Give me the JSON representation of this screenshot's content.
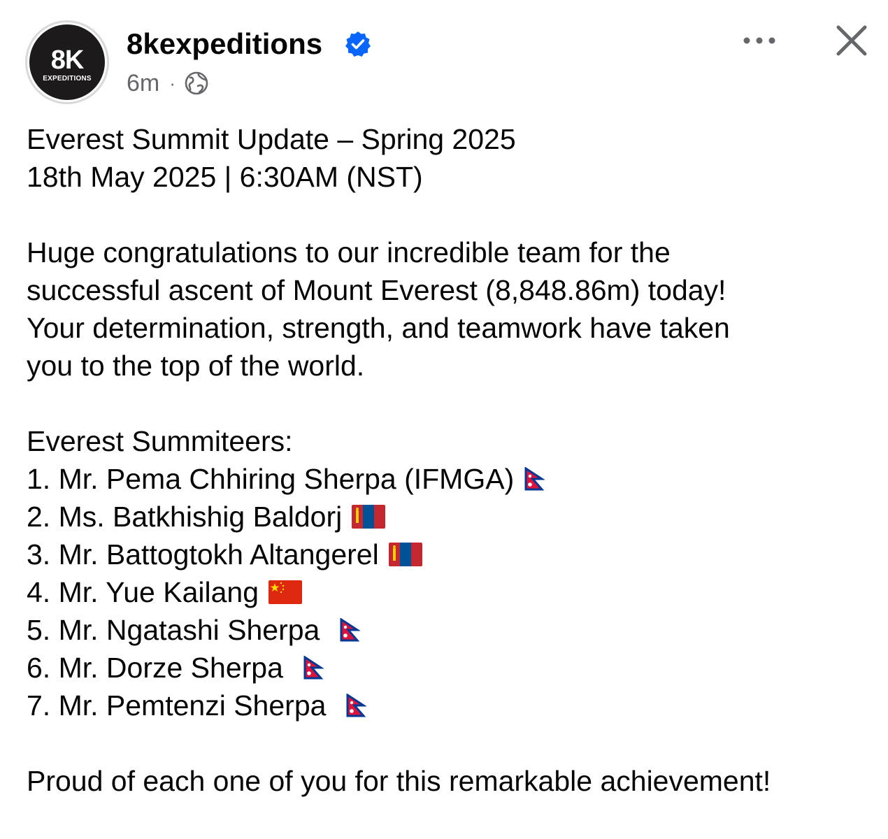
{
  "header": {
    "avatar_mark": "8K",
    "avatar_sub": "EXPEDITIONS",
    "account_name": "8kexpeditions",
    "time_ago": "6m",
    "separator": "·",
    "privacy_icon": "globe-icon",
    "verified_icon": "verified-badge-icon",
    "more_icon": "more-options-icon",
    "close_icon": "close-icon",
    "verified_color": "#0866ff"
  },
  "post": {
    "title": "Everest Summit Update – Spring 2025",
    "datetime": "18th May 2025 | 6:30AM (NST)",
    "paragraph_lines": [
      "Huge congratulations to our incredible team for the",
      "successful ascent of Mount Everest (8,848.86m) today!",
      "Your determination, strength, and teamwork have taken",
      "you to the top of the world."
    ],
    "summiteers_heading": "Everest Summiteers:",
    "summiteers": [
      {
        "text": "1. Mr. Pema Chhiring Sherpa (IFMGA)",
        "flag": "nepal-flag-icon"
      },
      {
        "text": "2. Ms. Batkhishig Baldorj",
        "flag": "mongolia-flag-icon"
      },
      {
        "text": "3. Mr. Battogtokh Altangerel",
        "flag": "mongolia-flag-icon"
      },
      {
        "text": "4. Mr. Yue Kailang",
        "flag": "china-flag-icon"
      },
      {
        "text": "5. Mr. Ngatashi Sherpa",
        "flag": "nepal-flag-icon"
      },
      {
        "text": "6. Mr. Dorze Sherpa",
        "flag": "nepal-flag-icon"
      },
      {
        "text": "7. Mr. Pemtenzi Sherpa",
        "flag": "nepal-flag-icon"
      }
    ],
    "closing": "Proud of each one of you for this remarkable achievement!"
  }
}
